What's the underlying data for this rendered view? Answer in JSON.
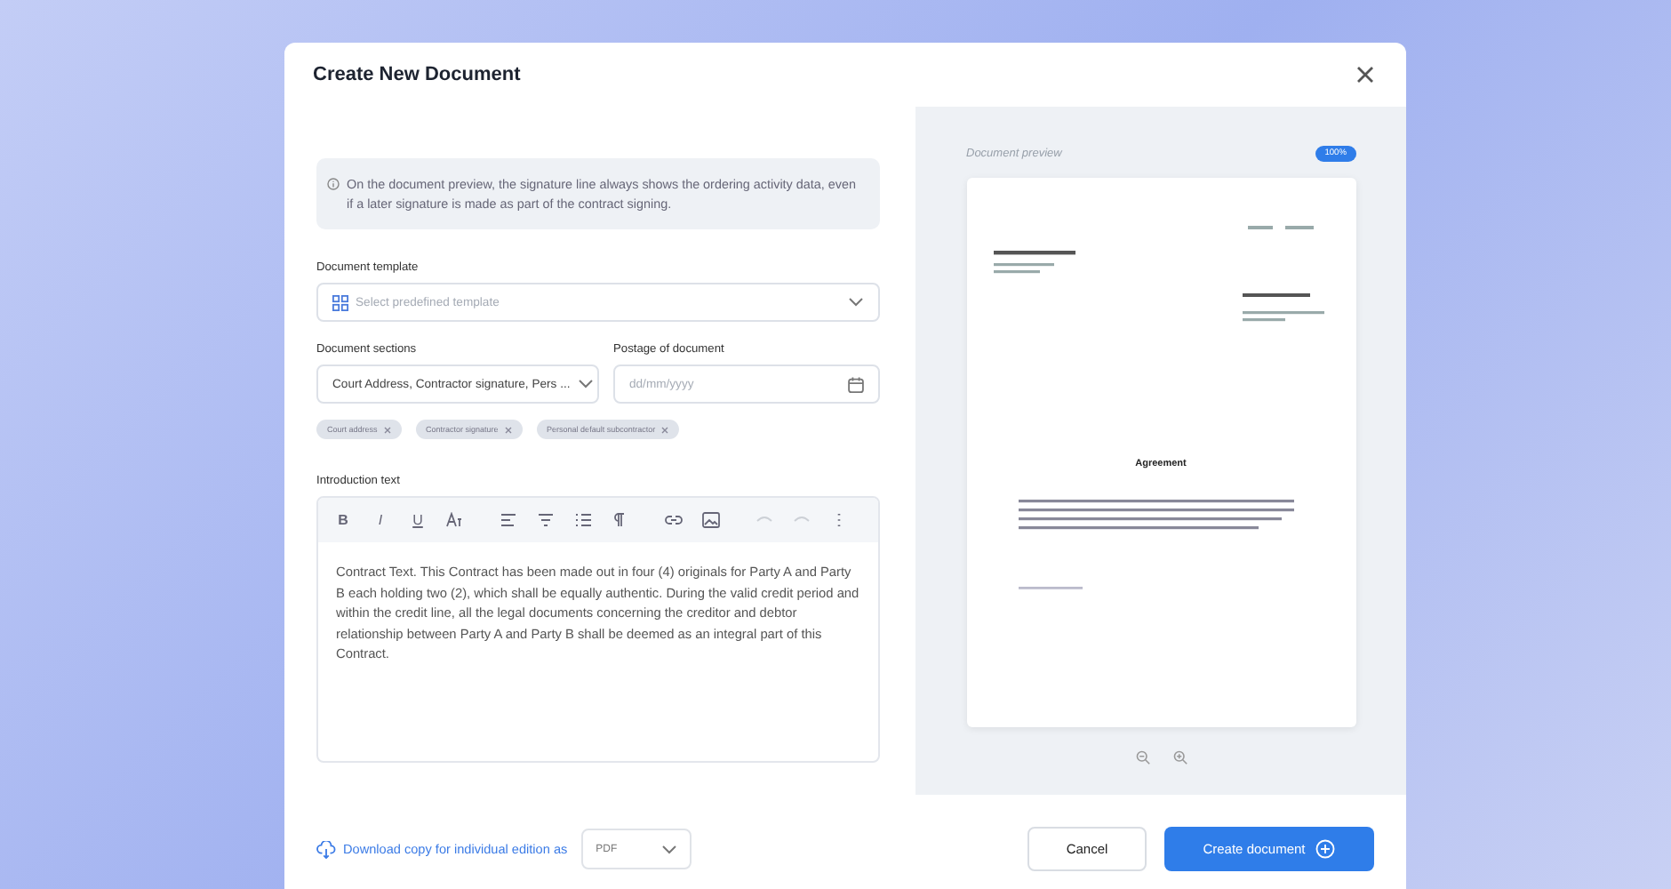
{
  "dialog": {
    "title": "Create New Document"
  },
  "info": "On the document preview, the signature line always shows the ordering activity data, even if a later signature is made as part of the contract signing.",
  "template": {
    "label": "Document template",
    "placeholder": "Select predefined template"
  },
  "sections": {
    "label": "Document sections",
    "value": "Court Address, Contractor signature, Pers ..."
  },
  "postage": {
    "label": "Postage of document",
    "placeholder": "dd/mm/yyyy"
  },
  "chips": [
    "Court address",
    "Contractor signature",
    "Personal default subcontractor"
  ],
  "intro": {
    "label": "Introduction text",
    "text": "Contract Text. This Contract has been made out in four (4) originals for Party A and Party B each holding two (2), which shall be equally authentic. During the valid credit period and within the credit line, all the legal documents concerning the creditor and debtor relationship between Party A and Party B shall be deemed as an integral part of this Contract.",
    "toolbar": [
      {
        "kind": "bold",
        "label": "B",
        "disabled": false
      },
      {
        "kind": "italic",
        "label": "I",
        "disabled": false
      },
      {
        "kind": "underline",
        "label": "U",
        "disabled": false
      },
      {
        "kind": "text-size",
        "disabled": false
      },
      {
        "kind": "align-left",
        "disabled": false
      },
      {
        "kind": "align-center",
        "disabled": false
      },
      {
        "kind": "list",
        "disabled": false
      },
      {
        "kind": "paragraph",
        "disabled": false
      },
      {
        "kind": "link",
        "disabled": false
      },
      {
        "kind": "image",
        "disabled": false
      },
      {
        "kind": "undo",
        "disabled": true
      },
      {
        "kind": "redo",
        "disabled": true
      },
      {
        "kind": "more",
        "disabled": false
      }
    ]
  },
  "preview": {
    "title": "Document preview",
    "zoom": "100%",
    "heading": "Agreement"
  },
  "footer": {
    "download": "Download copy for individual edition as",
    "format": "PDF",
    "cancel": "Cancel",
    "create": "Create document"
  }
}
